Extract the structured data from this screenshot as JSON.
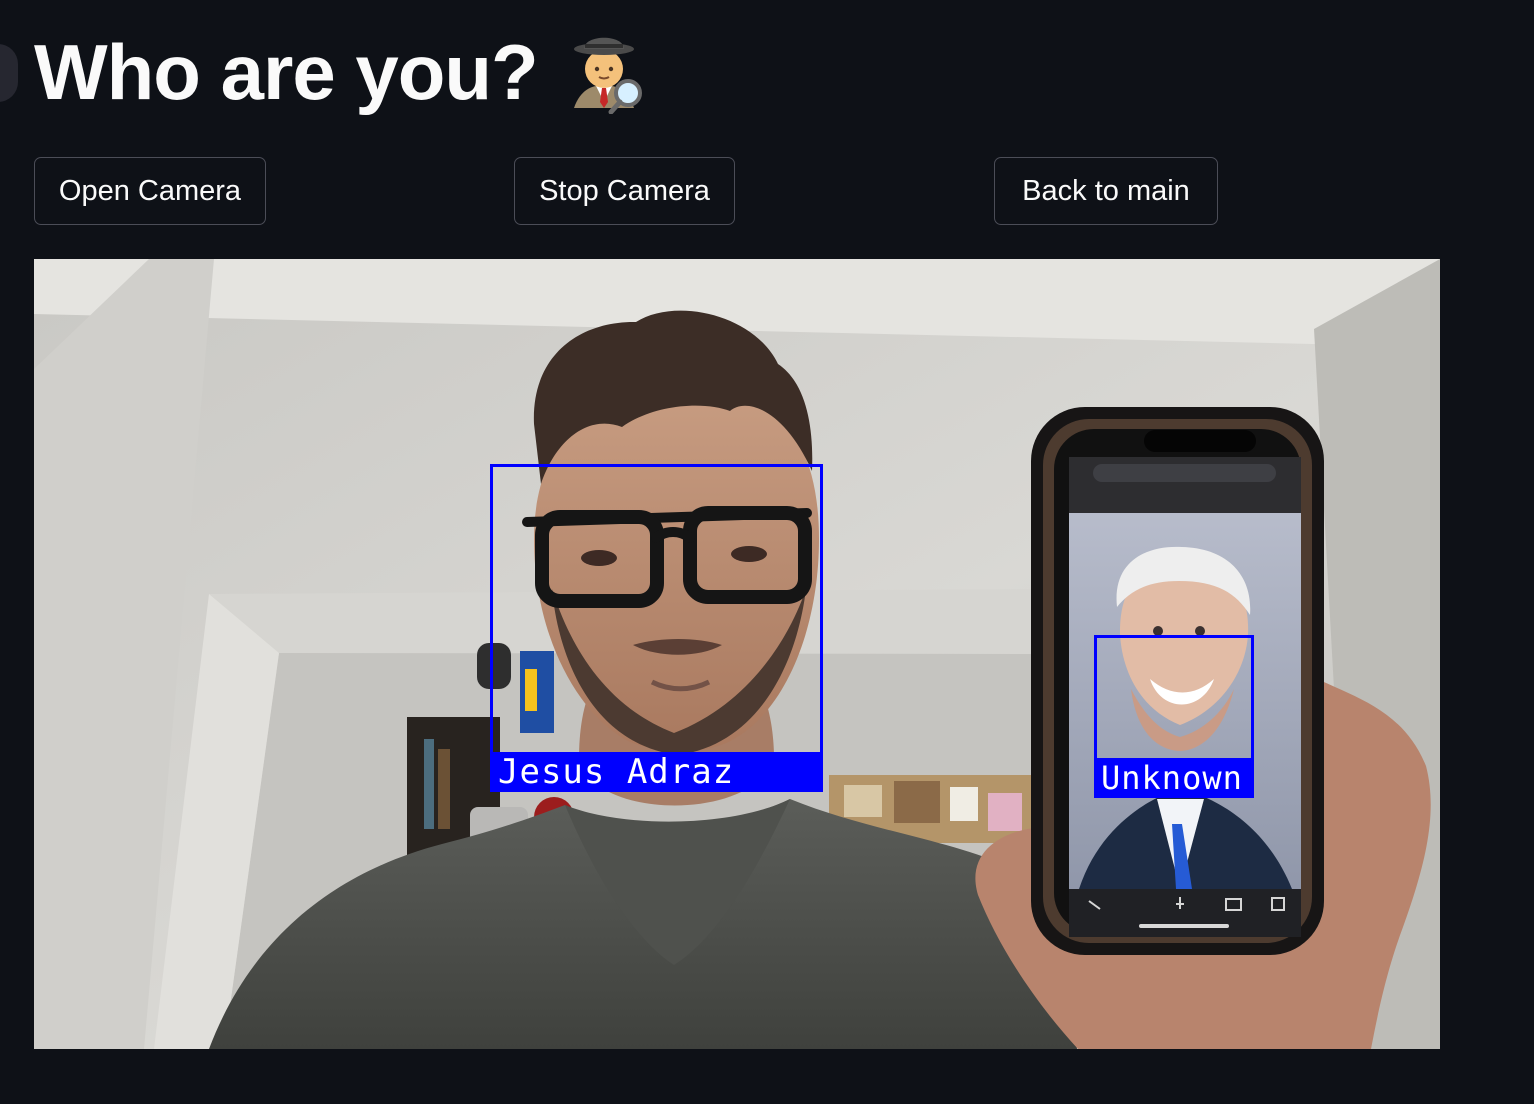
{
  "header": {
    "title": "Who are you?",
    "title_icon": "detective-icon"
  },
  "buttons": {
    "open_camera": "Open Camera",
    "stop_camera": "Stop Camera",
    "back_to_main": "Back to main"
  },
  "camera_feed": {
    "detections": [
      {
        "label": "Jesus Adraz"
      },
      {
        "label": "Unknown"
      }
    ]
  },
  "colors": {
    "background": "#0e1117",
    "text": "#fafafa",
    "button_border": "#4b4d57",
    "detection_box": "#0000ff"
  }
}
